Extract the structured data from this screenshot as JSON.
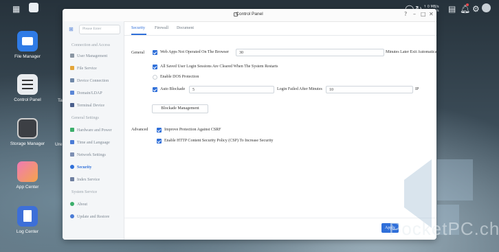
{
  "topbar": {
    "net_rate": "↑ 0 MB/s\n↓ 0 MB/s"
  },
  "desktop": {
    "icons": [
      {
        "label": "File Manager",
        "color": "#2f7be6"
      },
      {
        "label": "Control Panel",
        "color": "#e9ecef"
      },
      {
        "label": "Storage Manager",
        "color": "#3c3f44"
      },
      {
        "label": "App Center",
        "color": "#f4a44a"
      },
      {
        "label": "Log Center",
        "color": "#3d6fd8"
      }
    ],
    "partial_labels": [
      "Ta",
      "Ure"
    ]
  },
  "window": {
    "title": "Control Panel",
    "sidebar": {
      "search_placeholder": "Please Enter",
      "sections": [
        {
          "label": "Connection and Access"
        },
        {
          "label": "General Settings"
        },
        {
          "label": "System Service"
        }
      ],
      "items": [
        {
          "label": "User Management"
        },
        {
          "label": "File Service"
        },
        {
          "label": "Device Connection"
        },
        {
          "label": "Domain/LDAP"
        },
        {
          "label": "Terminal Device"
        },
        {
          "label": "Hardware and Power"
        },
        {
          "label": "Time and Language"
        },
        {
          "label": "Network Settings"
        },
        {
          "label": "Security"
        },
        {
          "label": "Index Service"
        },
        {
          "label": "About"
        },
        {
          "label": "Update and Restore"
        }
      ]
    },
    "tabs": [
      {
        "label": "Security"
      },
      {
        "label": "Firewall"
      },
      {
        "label": "Document"
      }
    ],
    "general": {
      "heading": "General",
      "auto_logout_label": "Web Apps Not Operated On The Browser",
      "auto_logout_value": "30",
      "auto_logout_suffix": "Minutes Later Exit Automatically",
      "clear_sessions_label": "All Saved User Login Sessions Are Cleared When The System Restarts",
      "dos_label": "Enable DOS Protection",
      "auto_block_label": "Auto Blockade",
      "auto_block_attempts": "5",
      "login_failed_label": "Login Failed After Minutes",
      "login_failed_minutes": "10",
      "ip_suffix": "IP",
      "blockade_button": "Blockade Management"
    },
    "advanced": {
      "heading": "Advanced",
      "csrf_label": "Improve Protection Against CSRF",
      "csp_label": "Enable HTTP Content Security Policy (CSP) To Increase Security"
    },
    "apply_label": "Apply"
  },
  "watermark": {
    "text": "PocketPC.ch"
  },
  "colors": {
    "accent": "#2f6fd9"
  }
}
